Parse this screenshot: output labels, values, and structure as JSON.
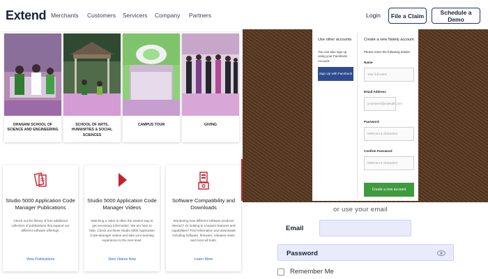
{
  "nav": {
    "logo": "Extend",
    "links": [
      "Merchants",
      "Customers",
      "Servicers",
      "Company",
      "Partners"
    ],
    "login": "Login",
    "file_claim": "File a Claim",
    "schedule_demo": "Schedule a Demo"
  },
  "schools": [
    {
      "label": "DHANANI SCHOOL OF SCIENCE AND ENGINEERING"
    },
    {
      "label": "SCHOOL OF ARTS, HUMANITIES & SOCIAL SCIENCES"
    },
    {
      "label": "CAMPUS TOUR"
    },
    {
      "label": "GIVING"
    }
  ],
  "products": [
    {
      "title": "Studio 5000 Application Code Manager Publications",
      "desc": "Check out the library of free additional collection of publications that support our different software offerings.",
      "link": "View Publications",
      "icon": "document-icon",
      "color": "#c8202f"
    },
    {
      "title": "Studio 5000 Application Code Manager Videos",
      "desc": "Watching a video is often the easiest way to get necessary information. We are here to help. Check out these Studio 5000 Application Code Manager videos and take your learning experience to the next level.",
      "link": "View Videos Now",
      "icon": "play-icon",
      "color": "#c8202f"
    },
    {
      "title": "Software Compatibility and Downloads",
      "desc": "Wondering how different software products interact? Or looking to compare features and capabilities? Find information and downloads including software, firmware, releases notes and more all tools.",
      "link": "Learn More",
      "icon": "download-icon",
      "color": "#c8202f"
    }
  ],
  "signup": {
    "other_accounts": "Use other accounts",
    "other_desc": "You can also sign up using your Facebook Account",
    "fb_button": "Sign Up with Facebook",
    "create_title": "Create a new Notely account",
    "create_desc": "Please enter the following details.",
    "name_label": "Name",
    "name_placeholder": "Your full name",
    "email_label": "Email Address",
    "email_placeholder": "yourname@example.com",
    "password_label": "Password",
    "password_placeholder": "Minimum 6 characters",
    "confirm_label": "Confirm Password",
    "confirm_placeholder": "Minimum 6 characters",
    "create_button": "Create a new account"
  },
  "login": {
    "or_use": "or use your email",
    "email_label": "Email",
    "password_label": "Password",
    "remember": "Remember Me"
  }
}
